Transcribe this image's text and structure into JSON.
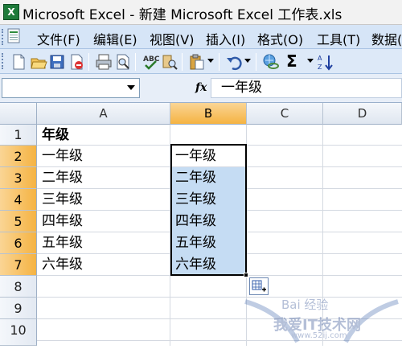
{
  "window": {
    "title": "Microsoft Excel - 新建 Microsoft Excel 工作表.xls",
    "app_icon_letter": "X"
  },
  "menu": {
    "items": [
      "文件(F)",
      "编辑(E)",
      "视图(V)",
      "插入(I)",
      "格式(O)",
      "工具(T)",
      "数据("
    ]
  },
  "toolbar": {
    "buttons": [
      "new-icon",
      "open-icon",
      "save-icon",
      "permission-icon",
      "print-icon",
      "print-preview-icon",
      "spelling-icon",
      "research-icon",
      "paste-icon",
      "undo-icon",
      "hyperlink-icon",
      "autosum-icon",
      "sort-ascending-icon"
    ],
    "autosum_symbol": "Σ"
  },
  "formula_bar": {
    "name_box": "",
    "fx": "fx",
    "content": "一年级"
  },
  "sheet": {
    "columns": [
      "A",
      "B",
      "C",
      "D"
    ],
    "selected_column": "B",
    "rows": [
      "1",
      "2",
      "3",
      "4",
      "5",
      "6",
      "7",
      "8",
      "9",
      "10"
    ],
    "column_a": [
      "年级",
      "一年级",
      "二年级",
      "三年级",
      "四年级",
      "五年级",
      "六年级"
    ],
    "column_b": [
      "",
      "一年级",
      "二年级",
      "三年级",
      "四年级",
      "五年级",
      "六年级"
    ]
  },
  "watermark": {
    "text": "Bai 经验",
    "site": "www.52ij.com",
    "label": "我爱IT技术网"
  }
}
